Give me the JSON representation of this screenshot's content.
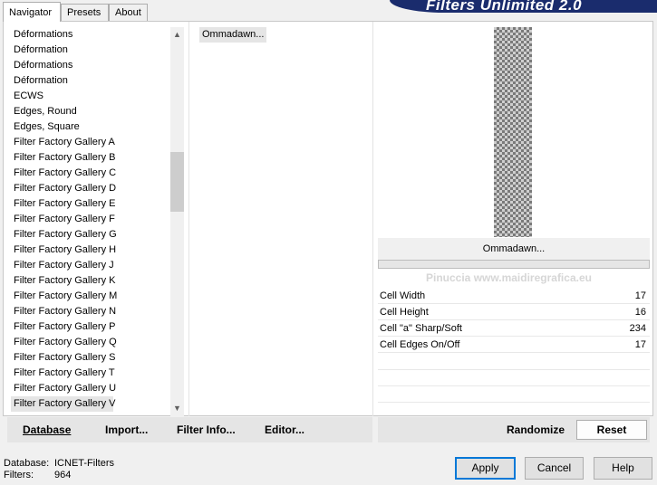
{
  "tabs": [
    {
      "label": "Navigator",
      "active": true
    },
    {
      "label": "Presets",
      "active": false
    },
    {
      "label": "About",
      "active": false
    }
  ],
  "banner_title": "Filters Unlimited 2.0",
  "categories": [
    "Déformations",
    "Déformation",
    "Déformations",
    "Déformation",
    "ECWS",
    "Edges, Round",
    "Edges, Square",
    "Filter Factory Gallery A",
    "Filter Factory Gallery B",
    "Filter Factory Gallery C",
    "Filter Factory Gallery D",
    "Filter Factory Gallery E",
    "Filter Factory Gallery F",
    "Filter Factory Gallery G",
    "Filter Factory Gallery H",
    "Filter Factory Gallery J",
    "Filter Factory Gallery K",
    "Filter Factory Gallery M",
    "Filter Factory Gallery N",
    "Filter Factory Gallery P",
    "Filter Factory Gallery Q",
    "Filter Factory Gallery S",
    "Filter Factory Gallery T",
    "Filter Factory Gallery U",
    "Filter Factory Gallery V"
  ],
  "selected_category": "Filter Factory Gallery V",
  "filters": [
    "Ommadawn..."
  ],
  "current_filter": "Ommadawn...",
  "params": [
    {
      "label": "Cell Width",
      "value": "17"
    },
    {
      "label": "Cell Height",
      "value": "16"
    },
    {
      "label": "Cell \"a\" Sharp/Soft",
      "value": "234"
    },
    {
      "label": "Cell Edges On/Off",
      "value": "17"
    }
  ],
  "watermark": "Pinuccia www.maidiregrafica.eu",
  "toolbar": {
    "database": "Database",
    "import": "Import...",
    "filter_info": "Filter Info...",
    "editor": "Editor...",
    "randomize": "Randomize",
    "reset": "Reset"
  },
  "footer": {
    "database_label": "Database:",
    "database_value": "ICNET-Filters",
    "filters_label": "Filters:",
    "filters_value": "964"
  },
  "buttons": {
    "apply": "Apply",
    "cancel": "Cancel",
    "help": "Help"
  },
  "colors": {
    "banner": "#1a2c6d",
    "default_button_border": "#0078d7"
  }
}
